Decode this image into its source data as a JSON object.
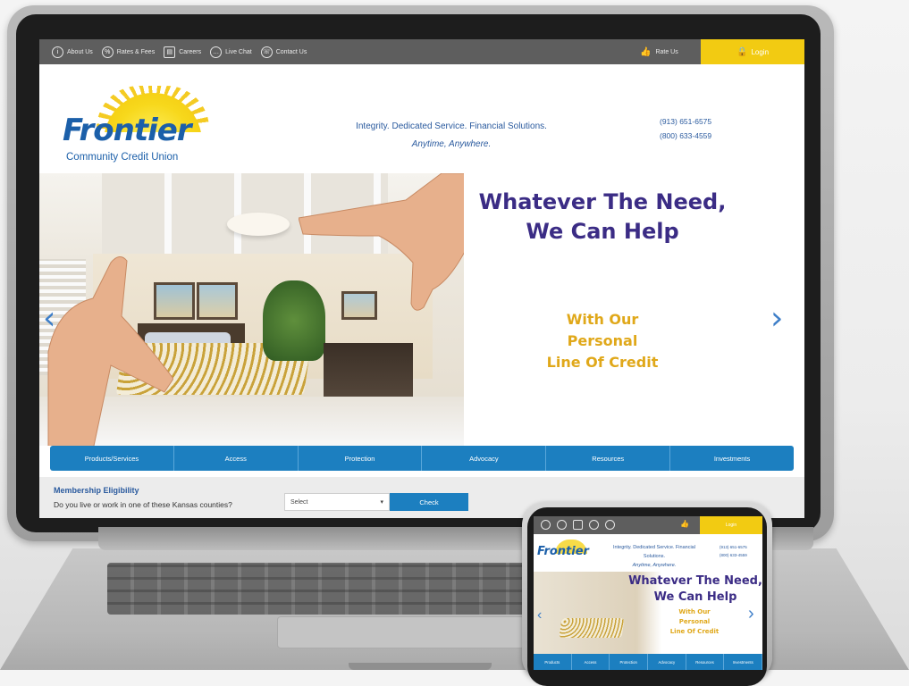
{
  "topbar": {
    "links": [
      {
        "label": "About Us",
        "icon": "info-icon"
      },
      {
        "label": "Rates & Fees",
        "icon": "percent-icon"
      },
      {
        "label": "Careers",
        "icon": "briefcase-icon"
      },
      {
        "label": "Live Chat",
        "icon": "chat-icon"
      },
      {
        "label": "Contact Us",
        "icon": "phone-icon"
      }
    ],
    "rate_us": "Rate Us",
    "login": "Login"
  },
  "header": {
    "logo_word": "Frontier",
    "logo_sub": "Community Credit Union",
    "tagline_line1": "Integrity. Dedicated Service. Financial Solutions.",
    "tagline_line2": "Anytime, Anywhere.",
    "phone_1": "(913) 651-6575",
    "phone_2": "(800) 633-4559"
  },
  "hero": {
    "title_line1": "Whatever The Need,",
    "title_line2": "We Can Help",
    "sub_line1": "With Our",
    "sub_line2": "Personal",
    "sub_line3": "Line Of Credit",
    "prev_arrow": "‹",
    "next_arrow": "›"
  },
  "mainnav": [
    "Products/Services",
    "Access",
    "Protection",
    "Advocacy",
    "Resources",
    "Investments"
  ],
  "membership": {
    "title": "Membership Eligibility",
    "question": "Do you live or work in one of these Kansas counties?",
    "select_value": "Select",
    "check_label": "Check"
  },
  "phone": {
    "logo_word": "Frontier",
    "tagline_line1": "Integrity. Dedicated Service. Financial",
    "tagline_line2": "Solutions.",
    "tagline_line3": "Anytime, Anywhere.",
    "phone_1": "(913) 651-6575",
    "phone_2": "(800) 633-4559",
    "title_line1": "Whatever The Need,",
    "title_line2": "We Can Help",
    "sub_line1": "With Our",
    "sub_line2": "Personal",
    "sub_line3": "Line Of Credit",
    "login": "Login",
    "nav": [
      "Products",
      "Access",
      "Protection",
      "Advocacy",
      "Resources",
      "Investments"
    ]
  },
  "colors": {
    "brand_blue": "#1c7fc0",
    "logo_blue": "#1b5fa9",
    "hero_purple": "#3b2c85",
    "hero_gold": "#e0a81a",
    "login_yellow": "#f2cb12",
    "topbar_gray": "#5e5e5e"
  }
}
